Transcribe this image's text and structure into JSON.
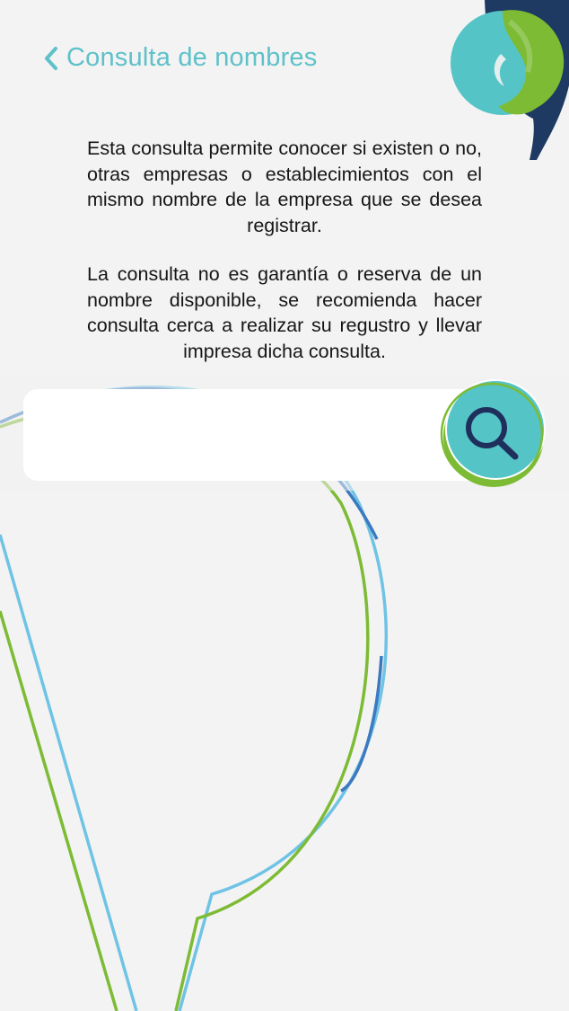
{
  "header": {
    "back_icon": "chevron-left-icon",
    "title": "Consulta de nombres"
  },
  "description": {
    "paragraph_1": "Esta consulta permite conocer si existen o no, otras empresas o establecimientos con el mismo nombre de la empresa que se desea registrar.",
    "paragraph_2": "La consulta no es garantía o reserva de un nombre disponible, se recomienda hacer consulta cerca a realizar su regustro y llevar impresa dicha consulta."
  },
  "search": {
    "value": "",
    "placeholder": "",
    "button_icon": "search-icon"
  },
  "logo": {
    "icon": "brand-logo-icon"
  },
  "colors": {
    "title": "#5ec1c9",
    "text": "#161616",
    "background": "#f3f3f3",
    "teal": "#55c4c6",
    "green": "#7dbb34",
    "light_blue": "#6fc3e5",
    "blue": "#3b79c0",
    "navy": "#1f3a62"
  }
}
